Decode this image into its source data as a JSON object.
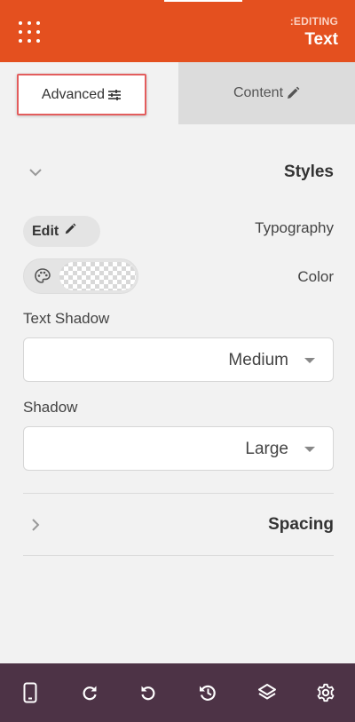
{
  "header": {
    "editing_label": ":EDITING",
    "title": "Text",
    "menu_icon": "grid-menu-icon"
  },
  "tabs": [
    {
      "label": "Advanced",
      "icon": "sliders-icon",
      "active": true
    },
    {
      "label": "Content",
      "icon": "pencil-icon",
      "active": false
    }
  ],
  "styles_section": {
    "title": "Styles",
    "expanded": true,
    "typography": {
      "button_label": "Edit",
      "label": "Typography"
    },
    "color": {
      "label": "Color"
    },
    "text_shadow": {
      "label": "Text Shadow",
      "value": "Medium"
    },
    "shadow": {
      "label": "Shadow",
      "value": "Large"
    }
  },
  "spacing_section": {
    "title": "Spacing",
    "expanded": false
  },
  "footer": {
    "buttons": [
      "mobile-icon",
      "redo-icon",
      "undo-icon",
      "history-icon",
      "layers-icon",
      "settings-icon"
    ]
  },
  "colors": {
    "header_bg": "#e4501f",
    "footer_bg": "#4d3346",
    "highlight": "#e35d5d"
  }
}
